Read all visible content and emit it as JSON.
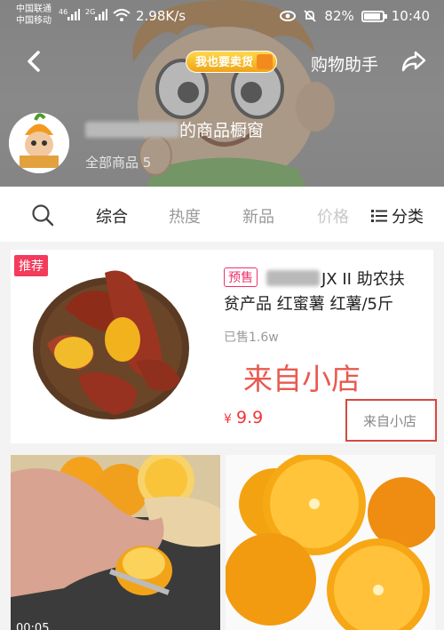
{
  "status_bar": {
    "carrier1": "中国联通",
    "carrier2": "中国移动",
    "sig1": "46",
    "sig2": "2G",
    "speed": "2.98K/s",
    "battery": "82%",
    "time": "10:40"
  },
  "header": {
    "sell_badge": "我也要卖货",
    "assistant": "购物助手",
    "store_name_suffix": "的商品橱窗",
    "all_goods": "全部商品 5"
  },
  "tabs": {
    "items": [
      "综合",
      "热度",
      "新品",
      "价格"
    ],
    "category": "分类"
  },
  "product": {
    "badge": "推荐",
    "presale": "预售",
    "title_line1": "JX II 助农扶",
    "title_line2": "贫产品 红蜜薯 红薯/5斤",
    "sold": "已售1.6w",
    "from_big": "来自小店",
    "price_currency": "¥",
    "price_value": "9.9",
    "from_small": "来自小店"
  },
  "video": {
    "timer": "00:05"
  },
  "colors": {
    "accent": "#f33b5b",
    "price": "#f2333a",
    "annotation": "#d44a3f"
  }
}
